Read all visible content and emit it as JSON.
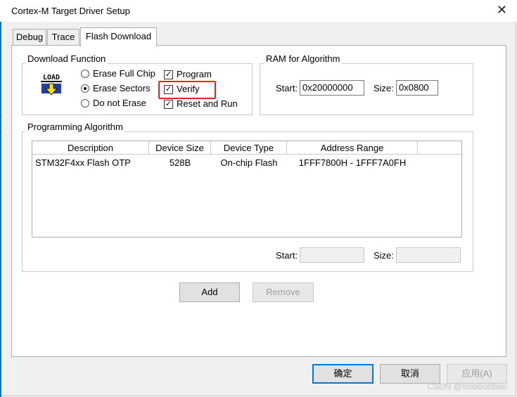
{
  "window": {
    "title": "Cortex-M Target Driver Setup",
    "close_glyph": "✕"
  },
  "tabs": [
    {
      "label": "Debug"
    },
    {
      "label": "Trace"
    },
    {
      "label": "Flash Download"
    }
  ],
  "download_function": {
    "title": "Download Function",
    "icon_name": "load-icon",
    "icon_text": "LOAD",
    "options": [
      {
        "label": "Erase Full Chip",
        "checked": false
      },
      {
        "label": "Erase Sectors",
        "checked": true
      },
      {
        "label": "Do not Erase",
        "checked": false
      }
    ],
    "checks": [
      {
        "label": "Program",
        "checked": true
      },
      {
        "label": "Verify",
        "checked": true
      },
      {
        "label": "Reset and Run",
        "checked": true
      }
    ],
    "check_glyph": "✓"
  },
  "ram_for_algorithm": {
    "title": "RAM for Algorithm",
    "start_label": "Start:",
    "start_value": "0x20000000",
    "size_label": "Size:",
    "size_value": "0x0800"
  },
  "programming_algorithm": {
    "title": "Programming Algorithm",
    "columns": [
      "Description",
      "Device Size",
      "Device Type",
      "Address Range"
    ],
    "rows": [
      {
        "description": "STM32F4xx Flash OTP",
        "device_size": "528B",
        "device_type": "On-chip Flash",
        "address_range": "1FFF7800H - 1FFF7A0FH"
      }
    ],
    "start_label": "Start:",
    "start_value": "",
    "size_label": "Size:",
    "size_value": ""
  },
  "buttons": {
    "add": "Add",
    "remove": "Remove",
    "ok": "确定",
    "cancel": "取消",
    "apply": "应用(A)"
  },
  "watermark": "CSDN @BobBobBao",
  "colors": {
    "accent": "#0078d7",
    "highlight": "#e8231d",
    "dialog_bg": "#f0f0f0"
  }
}
